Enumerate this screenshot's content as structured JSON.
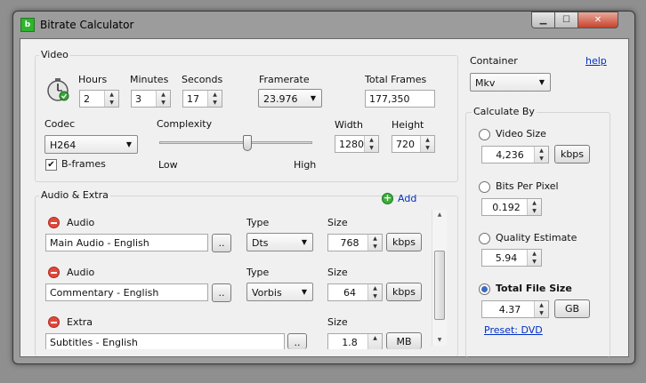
{
  "window": {
    "title": "Bitrate Calculator"
  },
  "video": {
    "group_label": "Video",
    "hours_label": "Hours",
    "hours": "2",
    "minutes_label": "Minutes",
    "minutes": "3",
    "seconds_label": "Seconds",
    "seconds": "17",
    "framerate_label": "Framerate",
    "framerate": "23.976",
    "total_frames_label": "Total Frames",
    "total_frames": "177,350",
    "codec_label": "Codec",
    "codec": "H264",
    "complexity_label": "Complexity",
    "complexity_low": "Low",
    "complexity_high": "High",
    "complexity_level": 0.58,
    "width_label": "Width",
    "width": "1280",
    "height_label": "Height",
    "height": "720",
    "bframes_label": "B-frames",
    "bframes_checked": true
  },
  "audio": {
    "group_label": "Audio & Extra",
    "add_label": "Add",
    "browse_label": "..",
    "type_label": "Type",
    "size_label": "Size",
    "tracks": [
      {
        "kind": "Audio",
        "name": "Main Audio - English",
        "type": "Dts",
        "size": "768",
        "unit": "kbps"
      },
      {
        "kind": "Audio",
        "name": "Commentary - English",
        "type": "Vorbis",
        "size": "64",
        "unit": "kbps"
      },
      {
        "kind": "Extra",
        "name": "Subtitles - English",
        "size": "1.8",
        "unit": "MB"
      }
    ]
  },
  "container": {
    "label": "Container",
    "help": "help",
    "value": "Mkv"
  },
  "calculate": {
    "group_label": "Calculate By",
    "video_size_label": "Video Size",
    "video_size": "4,236",
    "video_size_unit": "kbps",
    "bpp_label": "Bits Per Pixel",
    "bpp": "0.192",
    "quality_label": "Quality Estimate",
    "quality": "5.94",
    "total_label": "Total File Size",
    "total": "4.37",
    "total_unit": "GB",
    "selected": "total",
    "preset": "Preset: DVD"
  }
}
